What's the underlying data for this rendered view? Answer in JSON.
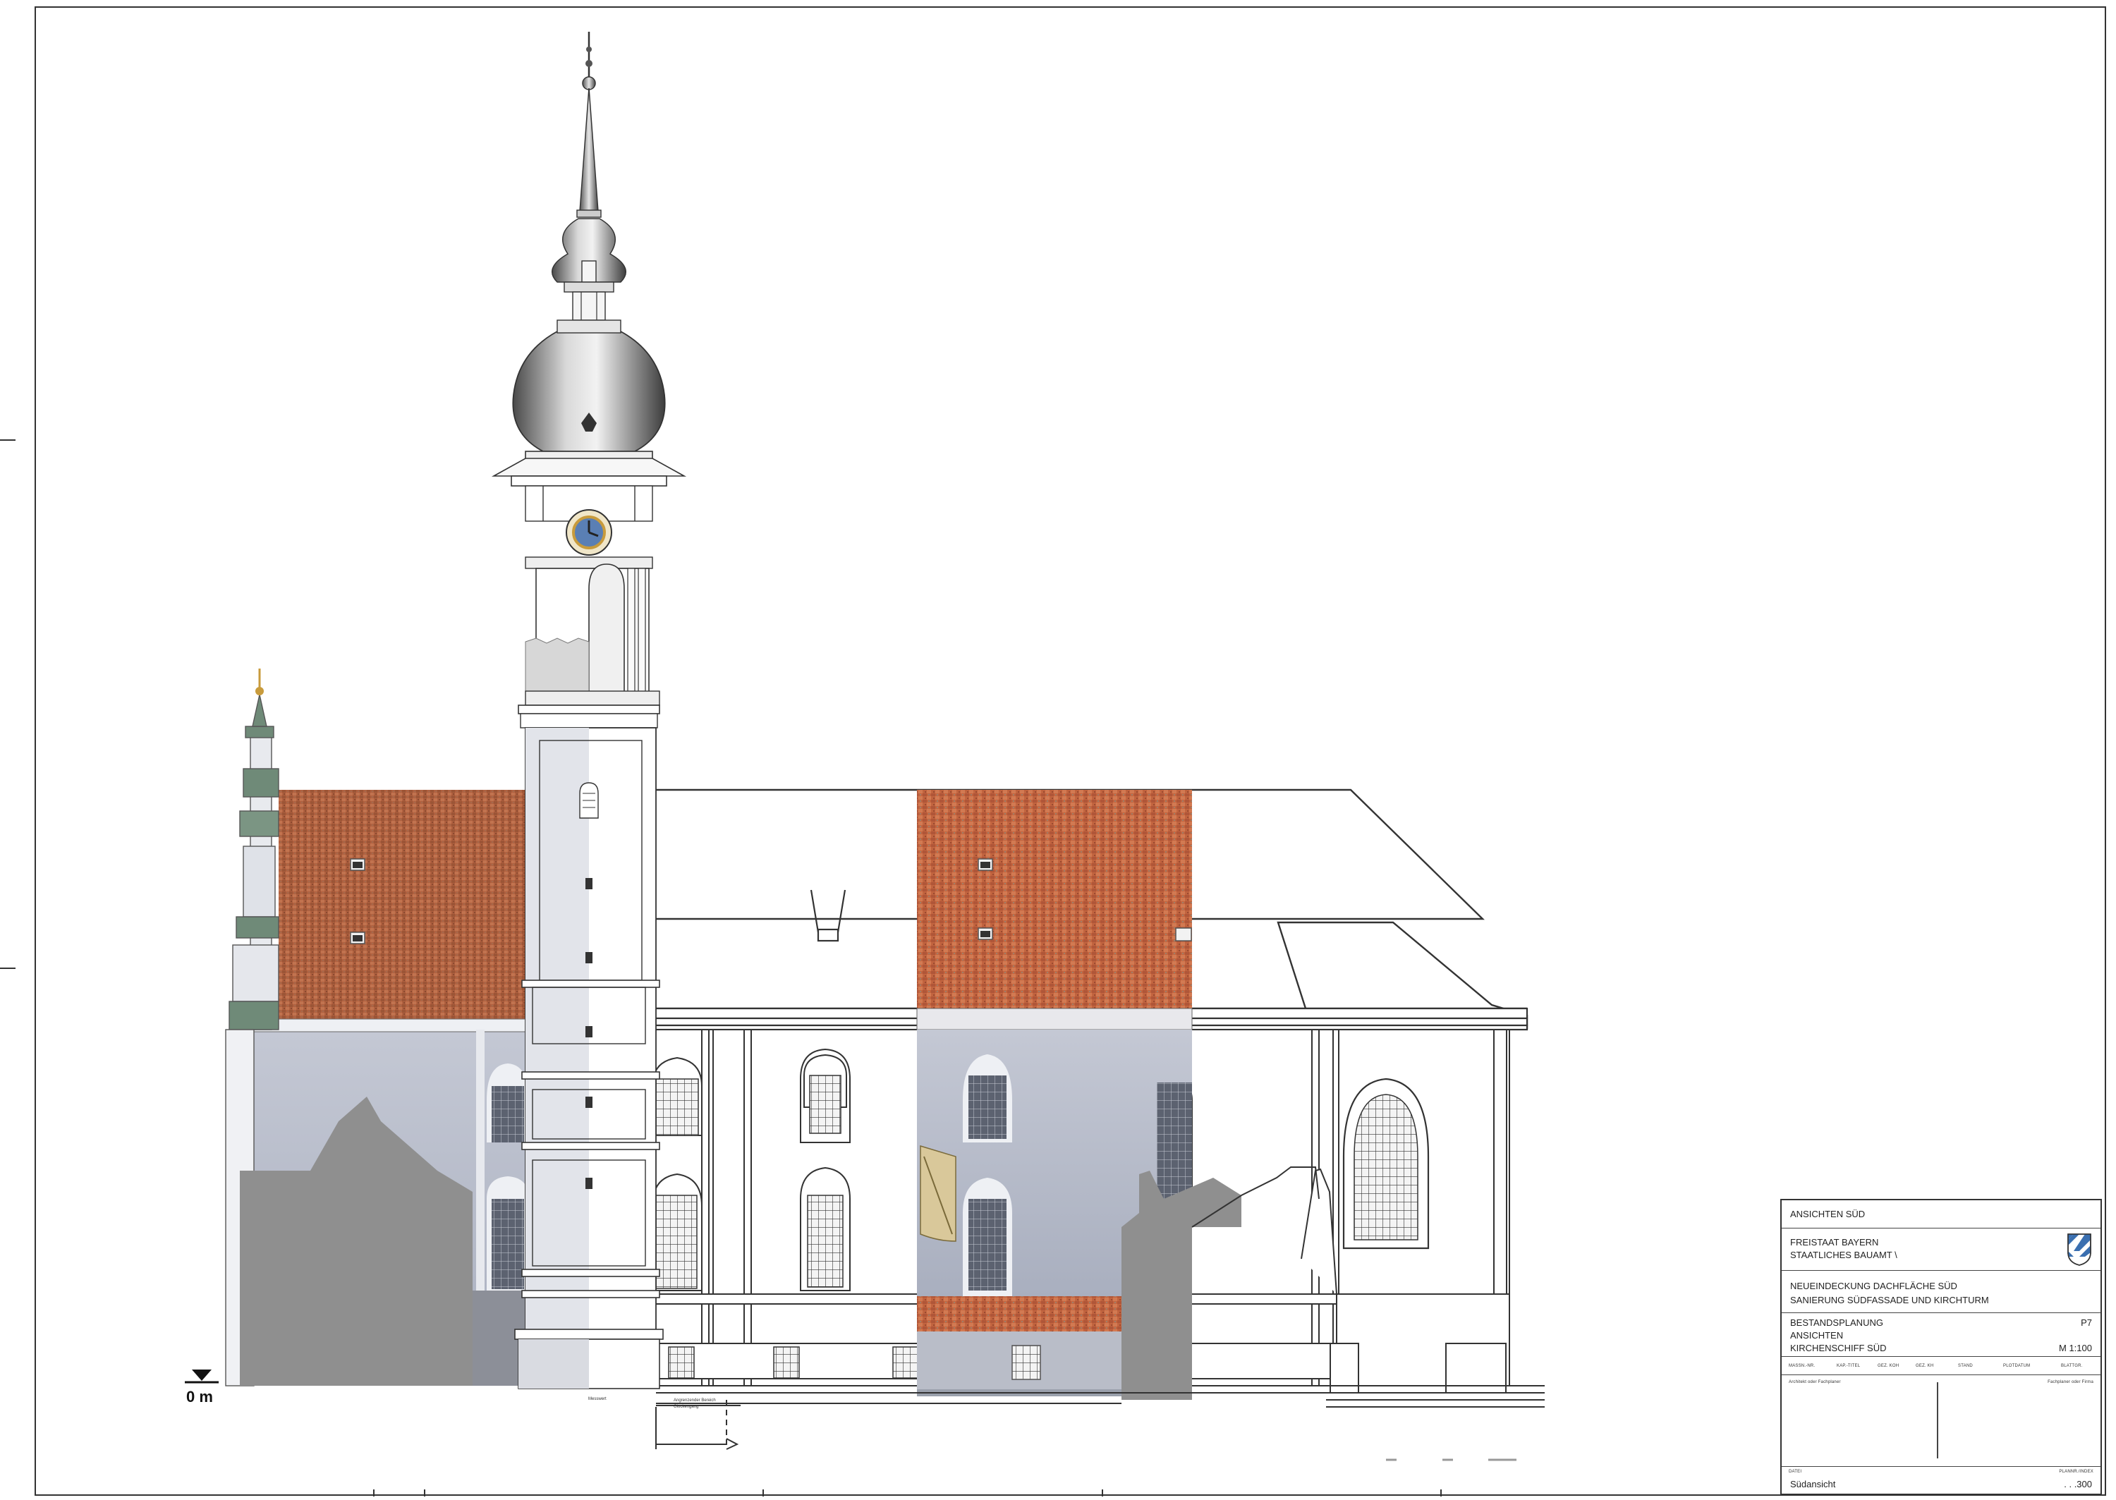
{
  "sheet": {
    "zero_level_label": "0 m",
    "notes": {
      "left_note": "Messwert",
      "boundary_note_1": "Angrenzender Bereich",
      "boundary_note_2": "Glockengang"
    }
  },
  "title_block": {
    "view_title": "ANSICHTEN SÜD",
    "authority_line_1": "FREISTAAT BAYERN",
    "authority_line_2": "STAATLICHES BAUAMT \\",
    "project_line_1": "NEUEINDECKUNG DACHFLÄCHE SÜD",
    "project_line_2": "SANIERUNG SÜDFASSADE UND KIRCHTURM",
    "phase": "BESTANDSPLANUNG",
    "plan_number": "P7",
    "plan_type": "ANSICHTEN",
    "plan_subject": "KIRCHENSCHIFF SÜD",
    "scale": "M 1:100",
    "info_headers": [
      "MASSN.-NR.",
      "KAP.-TITEL",
      "GEZ. KOH",
      "GEZ. KH",
      "STAND",
      "PLOTDATUM",
      "BLATTGR."
    ],
    "signature_left_label": "Architekt oder Fachplaner",
    "signature_right_label": "Fachplaner oder Firma",
    "date_label": "DATEI",
    "plan_index_label": "PLANNR./INDEX",
    "file_name": "Südansicht",
    "plan_index": ". . .300"
  },
  "colors": {
    "roof_tile": "#b25f3e",
    "facade_wall": "#b7bccb",
    "placeholder_grey": "#8f8f8f",
    "line": "#333333",
    "copper_green": "#6f8a78",
    "gilded": "#c89b3c"
  }
}
